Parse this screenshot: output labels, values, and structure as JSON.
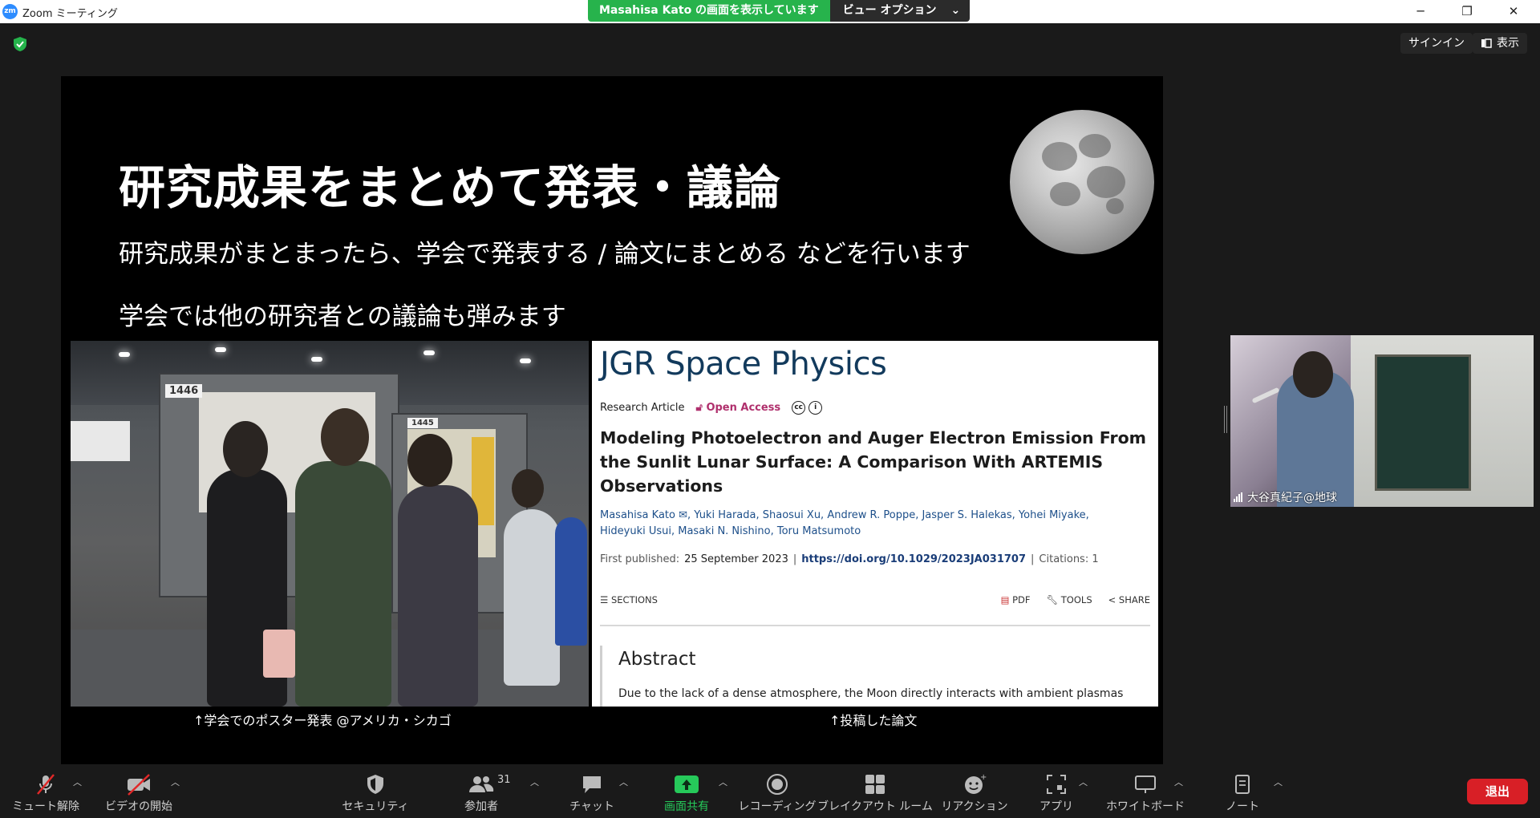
{
  "window": {
    "logo_text": "zm",
    "title": "Zoom ミーティング",
    "controls": [
      "─",
      "❐",
      "✕"
    ]
  },
  "share_banner": {
    "text": "Masahisa  Kato の画面を表示しています",
    "view_options": "ビュー オプション",
    "chevron": "⌄"
  },
  "top_right": {
    "signin": "サインイン",
    "show": "表示"
  },
  "slide": {
    "title": "研究成果をまとめて発表・議論",
    "line1": "研究成果がまとまったら、学会で発表する / 論文にまとめる などを行います",
    "line2": "学会では他の研究者との議論も弾みます",
    "photo_signs": [
      "1446",
      "1445"
    ],
    "photo_caption": "↑学会でのポスター発表 @アメリカ・シカゴ",
    "paper_caption": "↑投稿した論文",
    "paper": {
      "journal": "JGR Space Physics",
      "article_type": "Research Article",
      "access": "Open Access",
      "title": "Modeling Photoelectron and Auger Electron Emission From the Sunlit Lunar Surface: A Comparison With ARTEMIS Observations",
      "authors_line1": "Masahisa Kato ✉, Yuki Harada, Shaosui Xu, Andrew R. Poppe, Jasper S. Halekas, Yohei Miyake,",
      "authors_line2": "Hideyuki Usui, Masaki N. Nishino, Toru Matsumoto",
      "first_published_label": "First published:",
      "first_published_date": "25 September 2023",
      "doi": "https://doi.org/10.1029/2023JA031707",
      "citations": "Citations: 1",
      "sections": "SECTIONS",
      "pdf": "PDF",
      "tools": "TOOLS",
      "share": "SHARE",
      "abstract_title": "Abstract",
      "abstract_text": "Due to the lack of a dense atmosphere, the Moon directly interacts with ambient plasmas"
    }
  },
  "participant": {
    "name": "大谷真紀子@地球"
  },
  "toolbar": {
    "mute": "ミュート解除",
    "video": "ビデオの開始",
    "security": "セキュリティ",
    "participants": "参加者",
    "participants_count": "31",
    "chat": "チャット",
    "share_screen": "画面共有",
    "record": "レコーディング",
    "breakout": "ブレイクアウト ルーム",
    "reactions": "リアクション",
    "apps": "アプリ",
    "whiteboard": "ホワイトボード",
    "notes": "ノート",
    "leave": "退出"
  },
  "colors": {
    "share_green": "#27b34c",
    "leave_red": "#d81f26",
    "journal_blue": "#123a5c",
    "open_access": "#b0306d"
  }
}
